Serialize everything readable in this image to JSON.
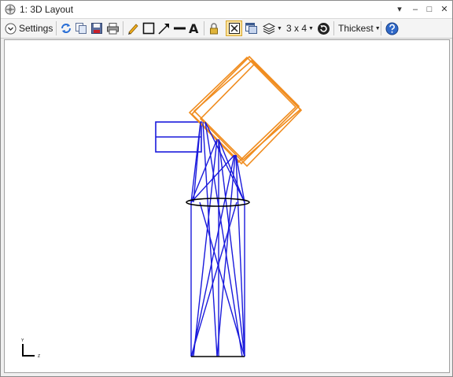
{
  "window": {
    "title": "1: 3D Layout",
    "controls": [
      "▾",
      "–",
      "□",
      "✕"
    ]
  },
  "toolbar": {
    "settings_label": "Settings",
    "grid_label": "3 x 4",
    "line_thickness_label": "Thickest",
    "text_tool_glyph": "A",
    "icons": [
      "settings-chevron-icon",
      "refresh-icon",
      "copy-icon",
      "save-icon",
      "print-icon",
      "pencil-icon",
      "rectangle-icon",
      "arrow-icon",
      "line-icon",
      "text-icon",
      "lock-icon",
      "fit-view-icon",
      "window-icon",
      "layers-icon",
      "rotate-icon",
      "help-icon"
    ]
  },
  "axis_indicator": {
    "vertical_label": "Y",
    "horizontal_label": "Z"
  },
  "colors": {
    "rays": "#1a1adc",
    "prism": "#f08c1e",
    "lens": "#000000",
    "pressed_button": "#fbe3a2"
  }
}
